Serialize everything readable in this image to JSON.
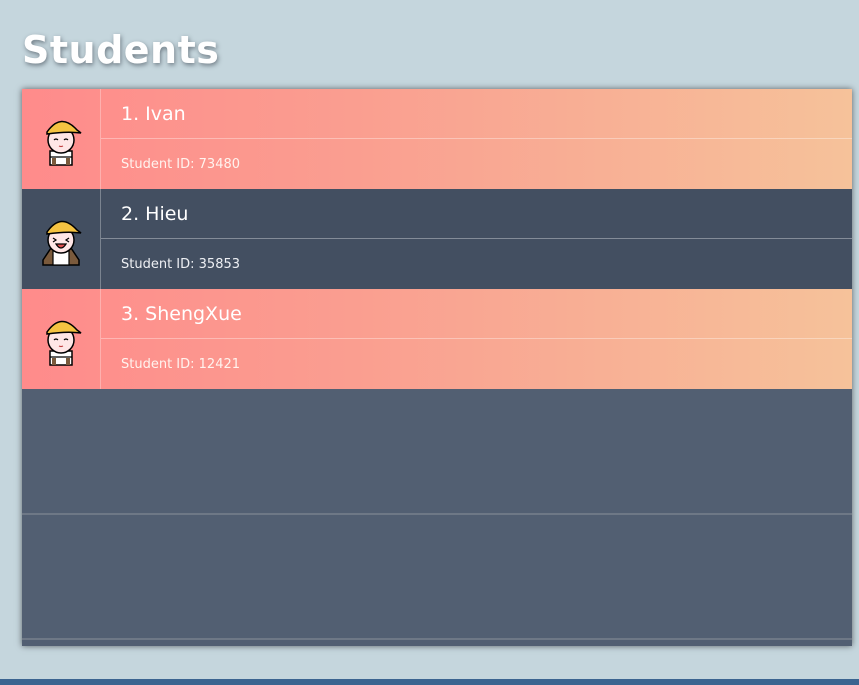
{
  "header": {
    "title": "Students"
  },
  "students": [
    {
      "name": "1. Ivan",
      "id_text": "Student ID: 73480",
      "selected": false,
      "expression": "neutral"
    },
    {
      "name": "2. Hieu",
      "id_text": "Student ID: 35853",
      "selected": true,
      "expression": "laughing"
    },
    {
      "name": "3. ShengXue",
      "id_text": "Student ID: 12421",
      "selected": false,
      "expression": "neutral"
    }
  ],
  "colors": {
    "background": "#c5d6dd",
    "panel": "#525f72",
    "selected_row": "#434f61",
    "row_gradient_start": "#ff8b8b",
    "row_gradient_end": "#f6c29a",
    "hat": "#f5c342",
    "bottom_bar": "#3b6490"
  }
}
